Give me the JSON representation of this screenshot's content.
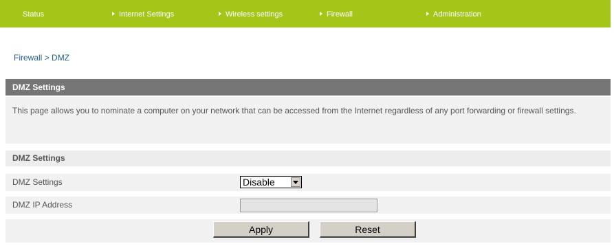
{
  "nav": {
    "status": "Status",
    "internet": "Internet Settings",
    "wireless": "Wireless settings",
    "firewall": "Firewall",
    "admin": "Administration"
  },
  "breadcrumb": {
    "section": "Firewall",
    "separator": ">",
    "page": "DMZ"
  },
  "panel": {
    "header": "DMZ Settings",
    "description": "This page allows you to nominate a computer on your network that can be accessed from the Internet regardless of any port forwarding or firewall settings.",
    "subheader": "DMZ Settings",
    "dmz_label": "DMZ Settings",
    "dmz_value": "Disable",
    "ip_label": "DMZ IP Address",
    "ip_value": "",
    "apply_label": "Apply",
    "reset_label": "Reset"
  },
  "colors": {
    "nav_bg": "#a4c618",
    "header_bg": "#767676",
    "row_bg": "#f1f1f1",
    "link": "#1d5c8e"
  }
}
